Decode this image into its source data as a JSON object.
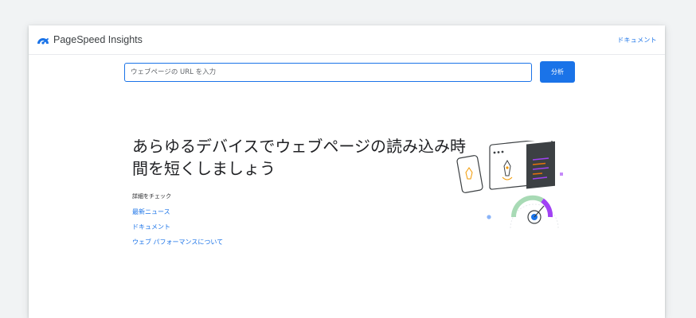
{
  "app": {
    "name": "PageSpeed Insights"
  },
  "header": {
    "docs_link": "ドキュメント"
  },
  "search": {
    "placeholder": "ウェブページの URL を入力",
    "value": "",
    "button_label": "分析"
  },
  "hero": {
    "title": "あらゆるデバイスでウェブページの読み込み時間を短くしましょう",
    "learn_more_label": "詳細をチェック",
    "links": [
      "最新ニュース",
      "ドキュメント",
      "ウェブ パフォーマンスについて"
    ]
  },
  "colors": {
    "accent": "#1a73e8",
    "purple": "#a142f4",
    "dark": "#3c4043"
  }
}
